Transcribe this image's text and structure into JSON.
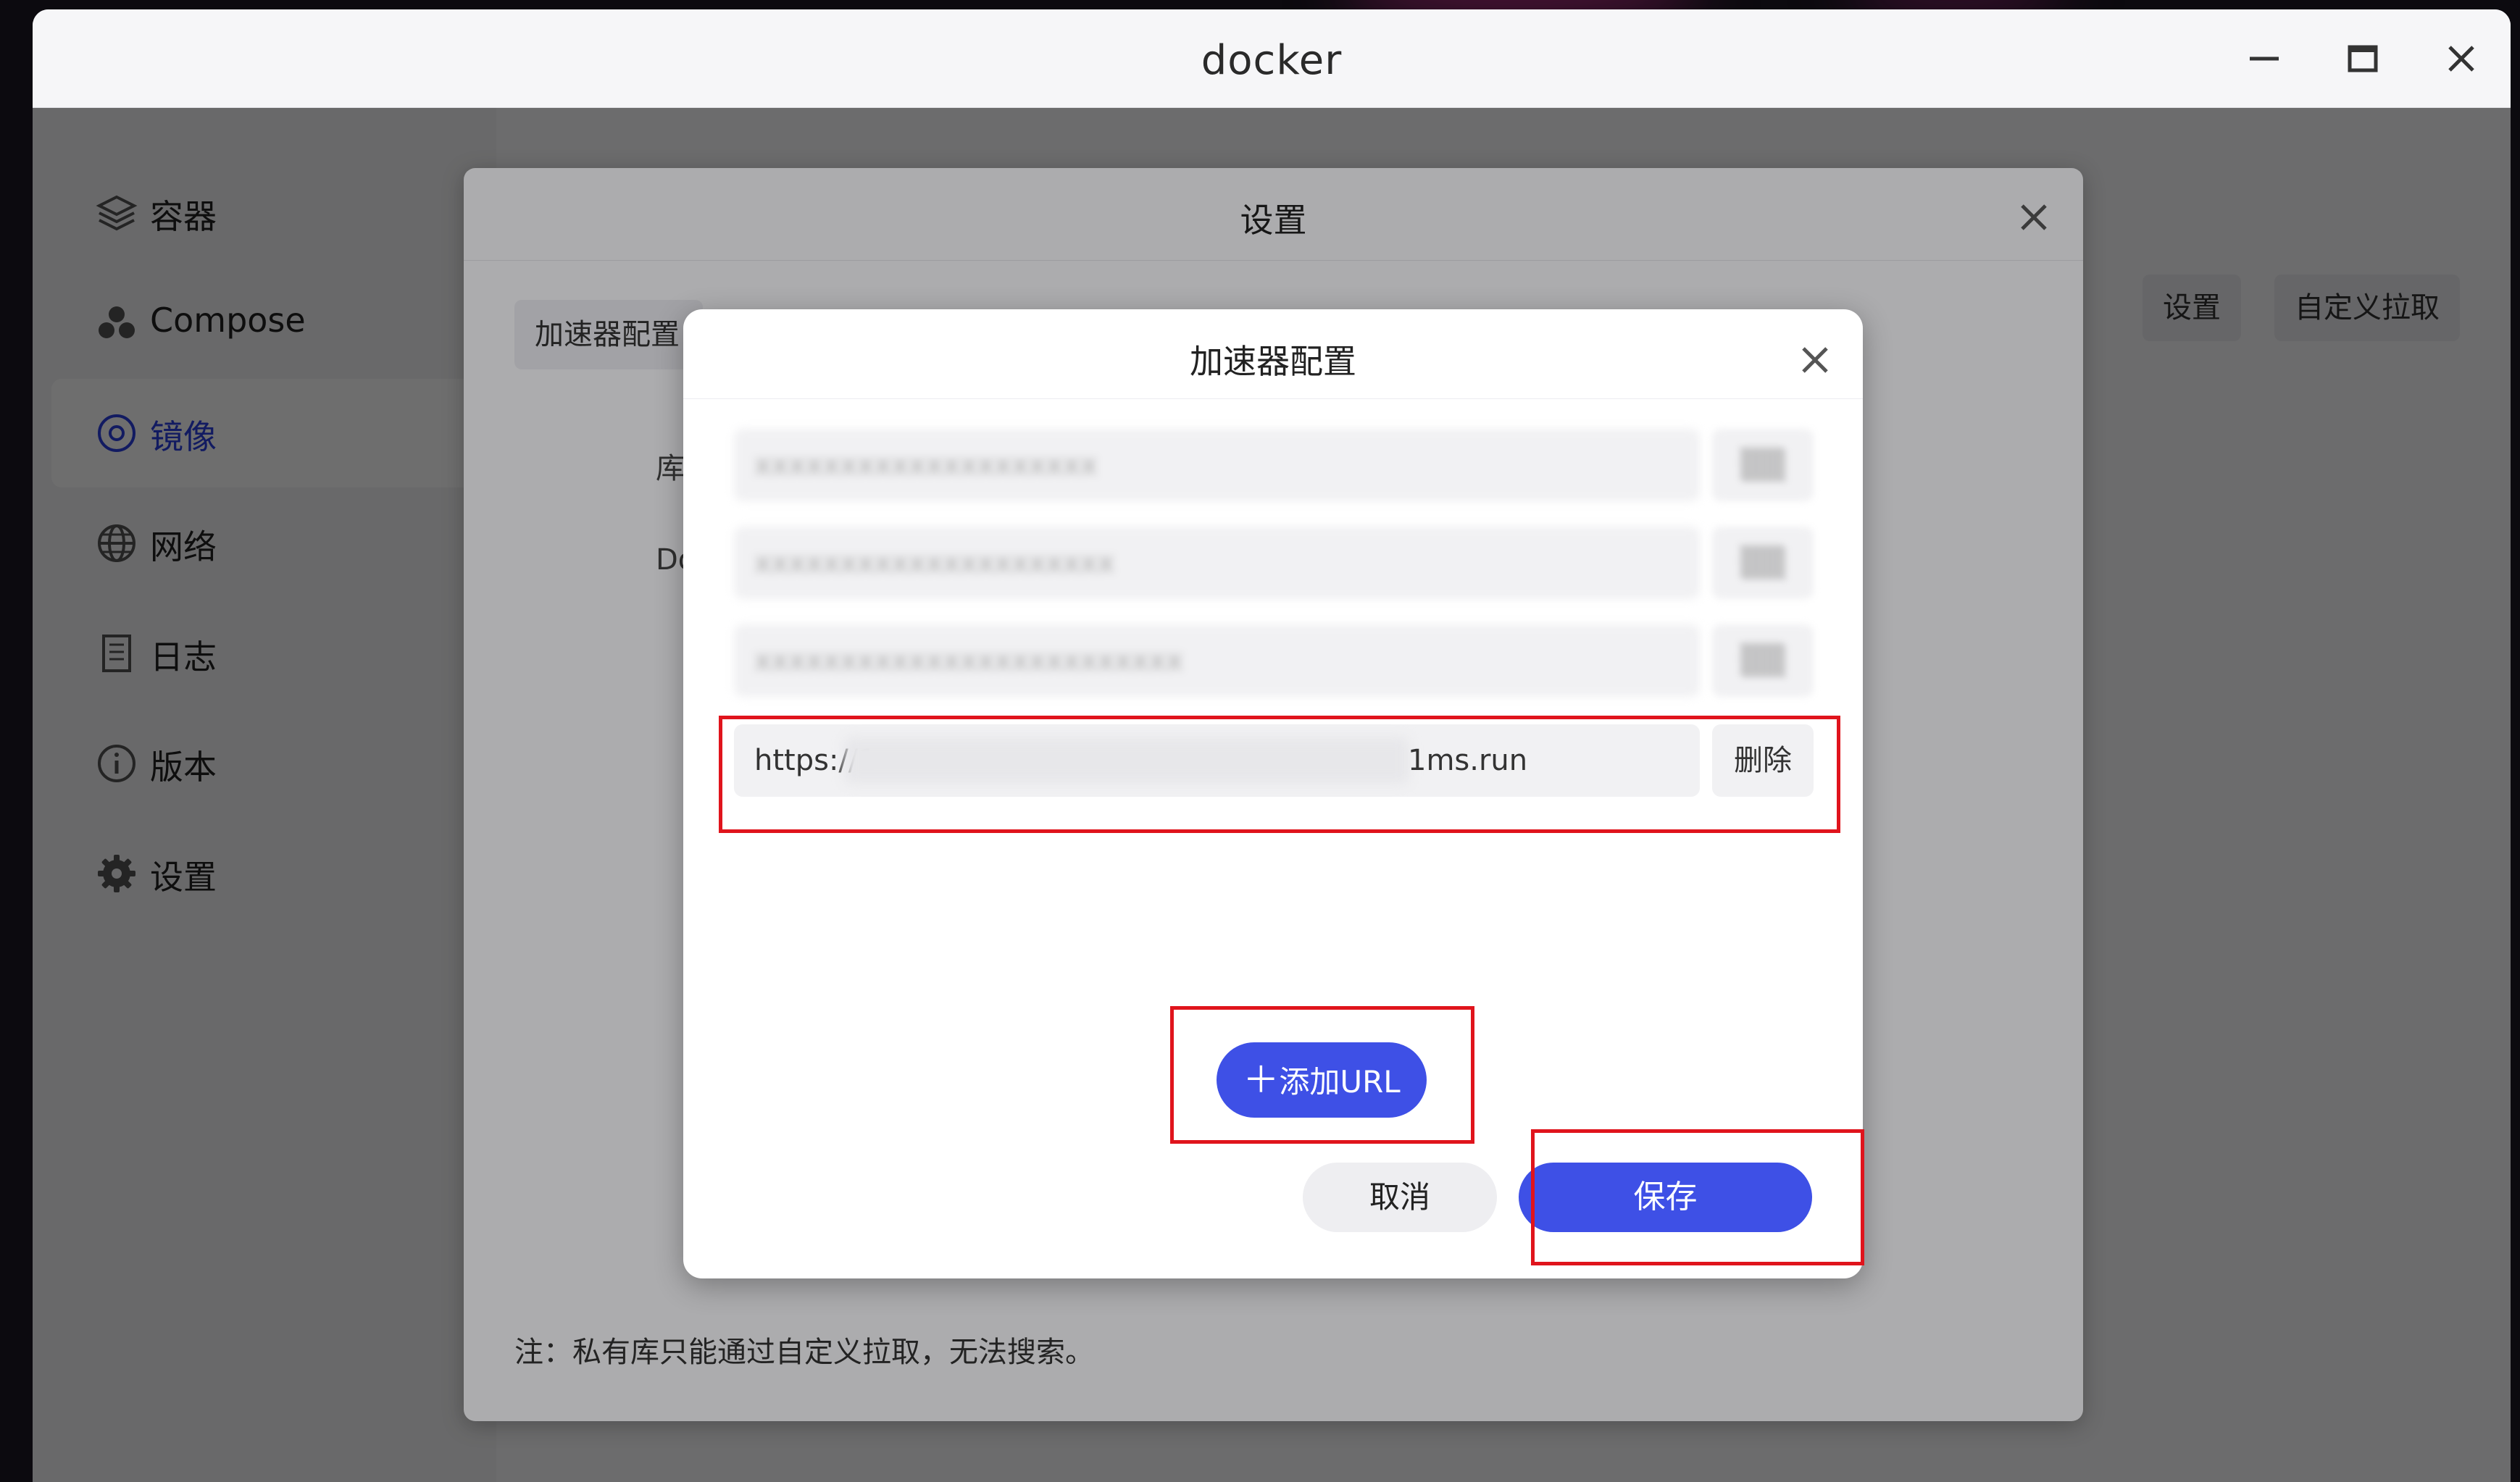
{
  "window": {
    "title": "docker"
  },
  "sidebar": {
    "items": [
      {
        "label": "容器",
        "icon": "layers-icon"
      },
      {
        "label": "Compose",
        "icon": "compose-icon"
      },
      {
        "label": "镜像",
        "icon": "disc-icon",
        "active": true
      },
      {
        "label": "网络",
        "icon": "globe-icon"
      },
      {
        "label": "日志",
        "icon": "log-icon"
      },
      {
        "label": "版本",
        "icon": "info-icon"
      },
      {
        "label": "设置",
        "icon": "gear-icon"
      }
    ]
  },
  "toolbar": {
    "settings_label": "设置",
    "custom_pull_label": "自定义拉取"
  },
  "settings_dialog": {
    "title": "设置",
    "tab_label": "加速器配置",
    "label_1": "库",
    "label_2": "Do",
    "note": "注：私有库只能通过自定义拉取，无法搜索。"
  },
  "accel_dialog": {
    "title": "加速器配置",
    "delete_label": "删除",
    "url_value": "https://1",
    "url_suffix": "1ms.run",
    "add_label": "添加URL",
    "cancel_label": "取消",
    "save_label": "保存"
  }
}
